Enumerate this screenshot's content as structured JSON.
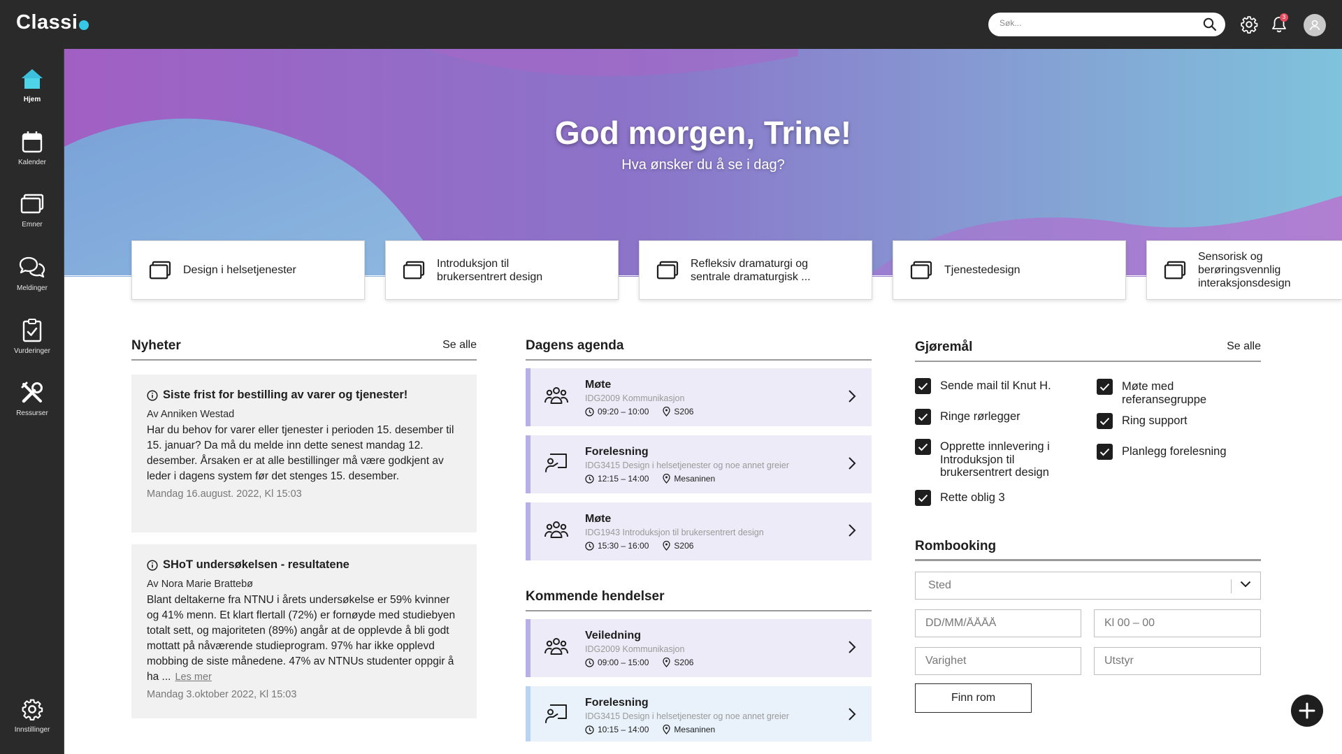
{
  "app": {
    "logo_text": "Classi",
    "logo_accent": "#36c6e6"
  },
  "topbar": {
    "search_placeholder": "Søk...",
    "notification_count": "3",
    "icons": [
      "search-icon",
      "gear-icon",
      "bell-icon",
      "user-avatar"
    ]
  },
  "sidebar": {
    "items": [
      {
        "label": "Hjem",
        "icon": "home-icon",
        "active": true
      },
      {
        "label": "Kalender",
        "icon": "calendar-icon"
      },
      {
        "label": "Emner",
        "icon": "courses-icon"
      },
      {
        "label": "Meldinger",
        "icon": "chat-icon"
      },
      {
        "label": "Vurderinger",
        "icon": "clipboard-check-icon"
      },
      {
        "label": "Ressurser",
        "icon": "tools-icon"
      },
      {
        "label": "Innstillinger",
        "icon": "gear-icon"
      }
    ]
  },
  "hero": {
    "title": "God morgen, Trine!",
    "subtitle": "Hva ønsker du å se i dag?"
  },
  "courses": [
    {
      "label": "Design i helsetjenester"
    },
    {
      "label": "Introduksjon til brukersentrert design"
    },
    {
      "label": "Refleksiv dramaturgi og sentrale dramaturgisk ..."
    },
    {
      "label": "Tjenestedesign"
    },
    {
      "label": "Sensorisk og berøringsvennlig interaksjonsdesign"
    }
  ],
  "news": {
    "title": "Nyheter",
    "see_all": "Se alle",
    "items": [
      {
        "title": "Siste frist for bestilling av varer og tjenester!",
        "author": "Av Anniken Westad",
        "body": "Har du behov for varer eller tjenester i perioden 15. desember til 15. januar? Da må du melde inn dette senest mandag 12. desember. Årsaken er at alle bestillinger må være godkjent av leder i dagens system før det stenges 15. desember.",
        "date": "Mandag 16.august. 2022, Kl 15:03"
      },
      {
        "title": "SHoT undersøkelsen - resultatene",
        "author": "Av Nora Marie Brattebø",
        "body": "Blant deltakerne fra NTNU i årets undersøkelse er 59% kvinner og 41% menn. Et klart flertall (72%) er fornøyde med studiebyen totalt sett, og majoriteten (89%) angår at de opplevde å bli godt mottatt på nåværende studieprogram. 97% har ikke opplevd mobbing de siste månedene. 47% av NTNUs studenter oppgir å ha ...",
        "read_more": "Les mer",
        "date": "Mandag 3.oktober 2022, Kl 15:03"
      }
    ]
  },
  "agenda": {
    "title": "Dagens agenda",
    "items": [
      {
        "title": "Møte",
        "course": "IDG2009 Kommunikasjon",
        "time": "09:20 – 10:00",
        "room": "S206",
        "icon": "group-icon"
      },
      {
        "title": "Forelesning",
        "course": "IDG3415 Design i helsetjenester og noe annet greier",
        "time": "12:15 – 14:00",
        "room": "Mesaninen",
        "icon": "lecture-icon"
      },
      {
        "title": "Møte",
        "course": "IDG1943 Introduksjon til brukersentrert design",
        "time": "15:30 – 16:00",
        "room": "S206",
        "icon": "group-icon"
      }
    ]
  },
  "events": {
    "title": "Kommende hendelser",
    "items": [
      {
        "title": "Veiledning",
        "course": "IDG2009 Kommunikasjon",
        "time": "09:00 – 15:00",
        "room": "S206",
        "icon": "group-icon"
      },
      {
        "title": "Forelesning",
        "course": "IDG3415 Design i helsetjenester og noe annet greier",
        "time": "10:15 – 14:00",
        "room": "Mesaninen",
        "icon": "lecture-icon"
      }
    ]
  },
  "todos": {
    "title": "Gjøremål",
    "see_all": "Se alle",
    "items": [
      {
        "label": "Sende mail til Knut H.",
        "checked": true
      },
      {
        "label": "Ringe rørlegger",
        "checked": true
      },
      {
        "label": "Opprette innlevering i Introduksjon til brukersentrert design",
        "checked": true
      },
      {
        "label": "Rette oblig 3",
        "checked": true
      },
      {
        "label": "Møte med referansegruppe",
        "checked": true
      },
      {
        "label": "Ring support",
        "checked": true
      },
      {
        "label": "Planlegg forelesning",
        "checked": true
      }
    ]
  },
  "booking": {
    "title": "Rombooking",
    "location_placeholder": "Sted",
    "date_placeholder": "DD/MM/ÅÅÅÅ",
    "time_placeholder": "Kl 00 – 00",
    "duration_placeholder": "Varighet",
    "equipment_placeholder": "Utstyr",
    "find_button": "Finn rom"
  },
  "colors": {
    "topbar": "#2a2a2a",
    "agenda_purple": "#ecebf7",
    "agenda_blue": "#e9f1fb",
    "news_bg": "#f1f1f1"
  }
}
